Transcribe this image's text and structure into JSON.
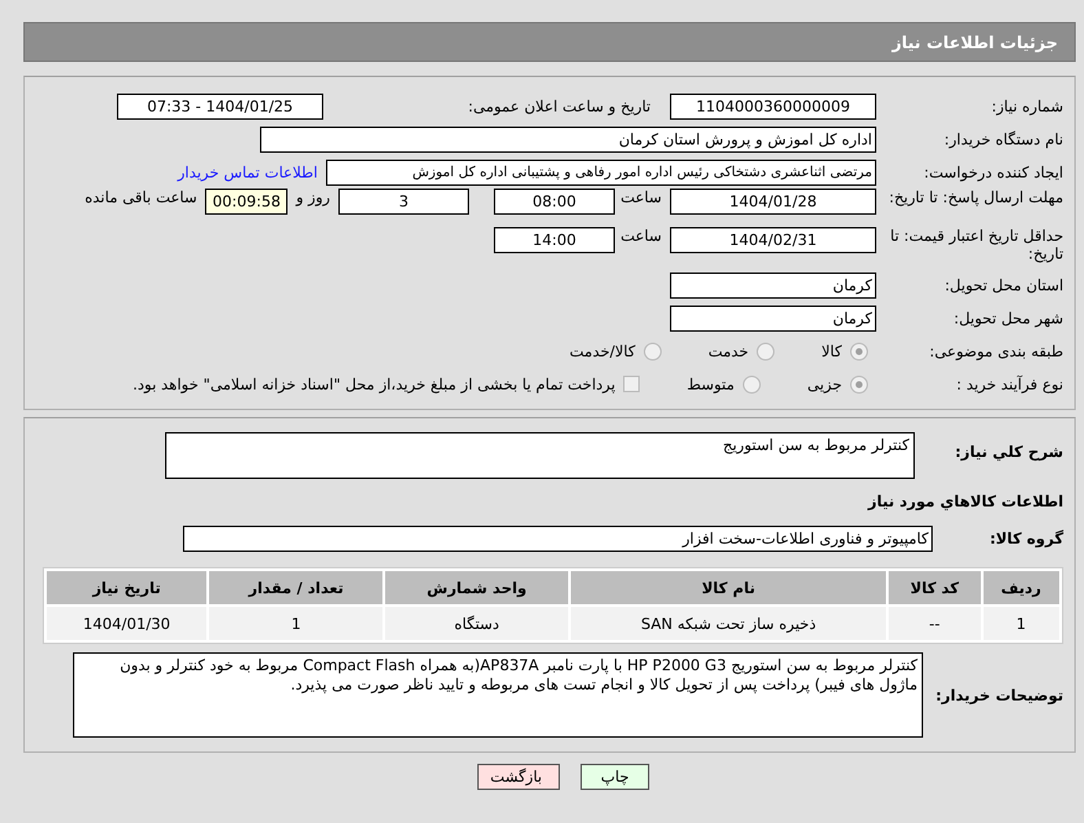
{
  "header": {
    "title": "جزئیات اطلاعات نیاز"
  },
  "need_number": {
    "label": "شماره نیاز:",
    "value": "1104000360000009"
  },
  "announce": {
    "label": "تاریخ و ساعت اعلان عمومی:",
    "value": "1404/01/25 - 07:33"
  },
  "buyer": {
    "label": "نام دستگاه خریدار:",
    "value": "اداره کل اموزش و پرورش استان کرمان"
  },
  "requester": {
    "label": "ایجاد کننده درخواست:",
    "value": "مرتضی اثناعشری دشتخاکی رئیس اداره امور رفاهی و پشتیبانی اداره کل اموزش",
    "link": "اطلاعات تماس خریدار"
  },
  "deadline": {
    "label": "مهلت ارسال پاسخ: تا تاریخ:",
    "date": "1404/01/28",
    "time_label": "ساعت",
    "time": "08:00",
    "days": "3",
    "days_label": "روز و",
    "remaining": "00:09:58",
    "remaining_label": "ساعت باقی مانده"
  },
  "validity": {
    "label": "حداقل تاریخ اعتبار قیمت: تا تاریخ:",
    "date": "1404/02/31",
    "time_label": "ساعت",
    "time": "14:00"
  },
  "province": {
    "label": "استان محل تحویل:",
    "value": "کرمان"
  },
  "city": {
    "label": "شهر محل تحویل:",
    "value": "کرمان"
  },
  "category": {
    "label": "طبقه بندی موضوعی:",
    "options": [
      {
        "label": "کالا",
        "selected": true
      },
      {
        "label": "خدمت",
        "selected": false
      },
      {
        "label": "کالا/خدمت",
        "selected": false
      }
    ]
  },
  "process": {
    "label": "نوع فرآیند خرید :",
    "options": [
      {
        "label": "جزیی",
        "selected": true
      },
      {
        "label": "متوسط",
        "selected": false
      }
    ],
    "payment": {
      "label": "پرداخت تمام یا بخشی از مبلغ خرید،از محل \"اسناد خزانه اسلامی\" خواهد بود.",
      "checked": false
    }
  },
  "summary": {
    "label": "شرح کلي نياز:",
    "value": "کنترلر مربوط به سن استوریج"
  },
  "goods_heading": "اطلاعات کالاهاي مورد نياز",
  "goods_group": {
    "label": "گروه کالا:",
    "value": "کامپیوتر و فناوری اطلاعات-سخت افزار"
  },
  "table": {
    "columns": [
      "ردیف",
      "کد کالا",
      "نام کالا",
      "واحد شمارش",
      "تعداد / مقدار",
      "تاریخ نیاز"
    ],
    "rows": [
      [
        "1",
        "--",
        "ذخیره ساز تحت شبکه SAN",
        "دستگاه",
        "1",
        "1404/01/30"
      ]
    ]
  },
  "notes": {
    "label": "توضیحات خریدار:",
    "value": "کنترلر مربوط به سن استوریج HP P2000 G3 با پارت نامبر AP837A(به همراه Compact Flash مربوط به خود کنترلر و بدون ماژول های فیبر) پرداخت پس از تحویل کالا و انجام تست های مربوطه و تایید ناظر صورت می پذیرد."
  },
  "buttons": [
    {
      "label": "چاپ",
      "kind": "print"
    },
    {
      "label": "بازگشت",
      "kind": "back"
    }
  ]
}
